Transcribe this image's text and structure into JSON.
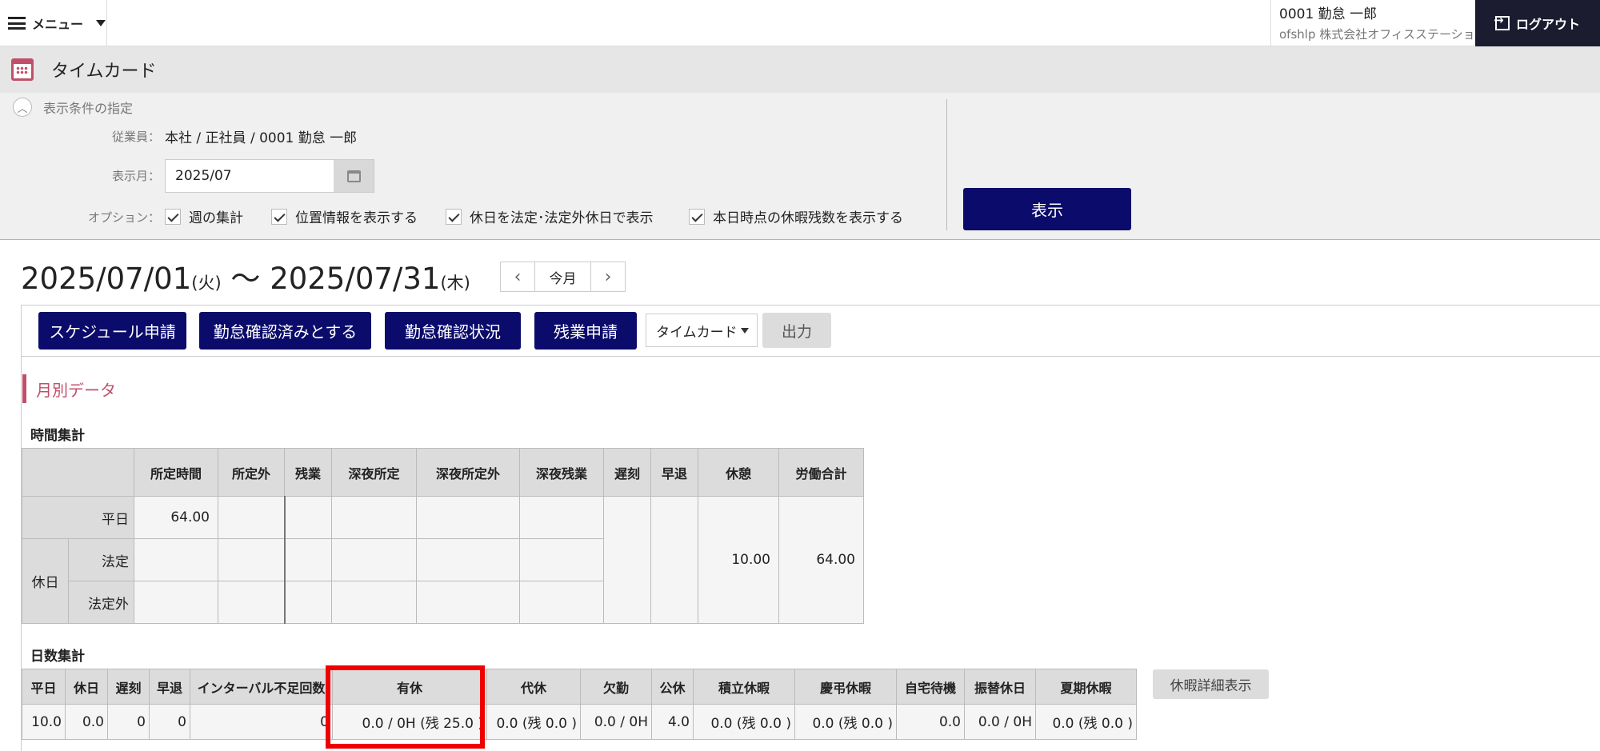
{
  "header": {
    "menu_label": "メニュー",
    "user_name": "0001 勤怠 一郎",
    "user_company": "ofshlp 株式会社オフィスステーション",
    "logout_label": "ログアウト"
  },
  "page": {
    "title": "タイムカード",
    "conditions_label": "表示条件の指定",
    "employee_label": "従業員：",
    "employee_value": "本社 / 正社員 / 0001 勤怠 一郎",
    "month_label": "表示月：",
    "month_value": "2025/07",
    "options_label": "オプション：",
    "options": [
      {
        "label": "週の集計",
        "checked": true
      },
      {
        "label": "位置情報を表示する",
        "checked": true
      },
      {
        "label": "休日を法定･法定外休日で表示",
        "checked": true
      },
      {
        "label": "本日時点の休暇残数を表示する",
        "checked": true
      }
    ],
    "show_button": "表示"
  },
  "range": {
    "start": "2025/07/01",
    "start_dow": "(火)",
    "sep": " 〜 ",
    "end": "2025/07/31",
    "end_dow": "(木)",
    "today_label": "今月"
  },
  "toolbar": {
    "buttons": [
      "スケジュール申請",
      "勤怠確認済みとする",
      "勤怠確認状況",
      "残業申請"
    ],
    "select_value": "タイムカード",
    "output_label": "出力"
  },
  "monthly": {
    "title": "月別データ",
    "time_summary": {
      "title": "時間集計",
      "headers": [
        "所定時間",
        "所定外",
        "残業",
        "深夜所定",
        "深夜所定外",
        "深夜残業",
        "遅刻",
        "早退",
        "休憩",
        "労働合計"
      ],
      "row_weekday": "平日",
      "row_holiday": "休日",
      "row_legal": "法定",
      "row_nonlegal": "法定外",
      "weekday_scheduled": "64.00",
      "break_total": "10.00",
      "work_total": "64.00"
    },
    "day_summary": {
      "title": "日数集計",
      "headers": [
        "平日",
        "休日",
        "遅刻",
        "早退",
        "インターバル不足回数",
        "有休",
        "代休",
        "欠勤",
        "公休",
        "積立休暇",
        "慶弔休暇",
        "自宅待機",
        "振替休日",
        "夏期休暇"
      ],
      "values": [
        "10.0",
        "0.0",
        "0",
        "0",
        "0",
        "0.0 / 0H (残 25.0 )",
        "0.0 (残 0.0 )",
        "0.0 / 0H",
        "4.0",
        "0.0 (残 0.0 )",
        "0.0 (残 0.0 )",
        "0.0",
        "0.0 / 0H",
        "0.0 (残 0.0 )"
      ],
      "detail_button": "休暇詳細表示"
    }
  },
  "colors": {
    "navy": "#0b0b6b",
    "accent": "#c0506a",
    "highlight": "#e00000"
  }
}
